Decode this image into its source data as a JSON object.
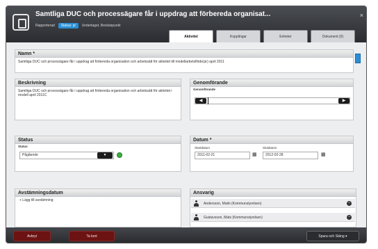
{
  "window": {
    "title": "Samtliga DUC och processägare får i uppdrag att förbereda organisat...",
    "meta_label": "Rapporterad",
    "badge": "Status: pl",
    "meta_text": "Underlaget, Beslutspunkt",
    "close_glyph": "×"
  },
  "tabs": [
    {
      "label": "Aktivitet",
      "active": true
    },
    {
      "label": "Kopplingar",
      "active": false
    },
    {
      "label": "Enheter",
      "active": false
    },
    {
      "label": "Dokument (0)",
      "active": false
    }
  ],
  "fields": {
    "name": {
      "title": "Namn *",
      "value": "Samtliga DUC och processägare får i uppdrag att förbereda organisation och arbetssätt för aktivitet till modellarbetsflöde(ar) april 2011"
    },
    "description": {
      "title": "Beskrivning",
      "value": "Samtliga DUC och processägare får i uppdrag att förbereda organisation och arbetssätt för aktivitet i modell april 2011C"
    },
    "implementation": {
      "title": "Genomförande",
      "sublabel": "Genomförande"
    },
    "status": {
      "title": "Status",
      "sublabel": "Status",
      "value": "Pågående",
      "select_glyph": "▼"
    },
    "dates": {
      "title": "Datum *",
      "start_label": "Startdatum",
      "start_value": "2011-02-21",
      "end_label": "Slutdatum",
      "end_value": "2012-02-28"
    },
    "reconciliation": {
      "title": "Avstämningsdatum",
      "add_label": "+ Lägg till avstämning"
    },
    "responsible": {
      "title": "Ansvarig",
      "people": [
        "Andersson, Malin (Kommunstyrelsen)",
        "Gustavsson, Mats (Kommunstyrelsen)"
      ]
    }
  },
  "footer": {
    "cancel": "Avbryt",
    "delete": "Ta bort",
    "save": "Spara och Stäng ▾"
  },
  "colors": {
    "accent": "#2a8fd6",
    "status_green": "#3fae3f",
    "header_dark": "#2a2c30"
  },
  "icons": {
    "window": "document-icon",
    "arrow_left": "arrow-left-icon",
    "arrow_right": "arrow-right-icon",
    "calendar": "calendar-icon",
    "person": "person-icon",
    "remove": "minus-icon",
    "add": "plus-icon"
  }
}
